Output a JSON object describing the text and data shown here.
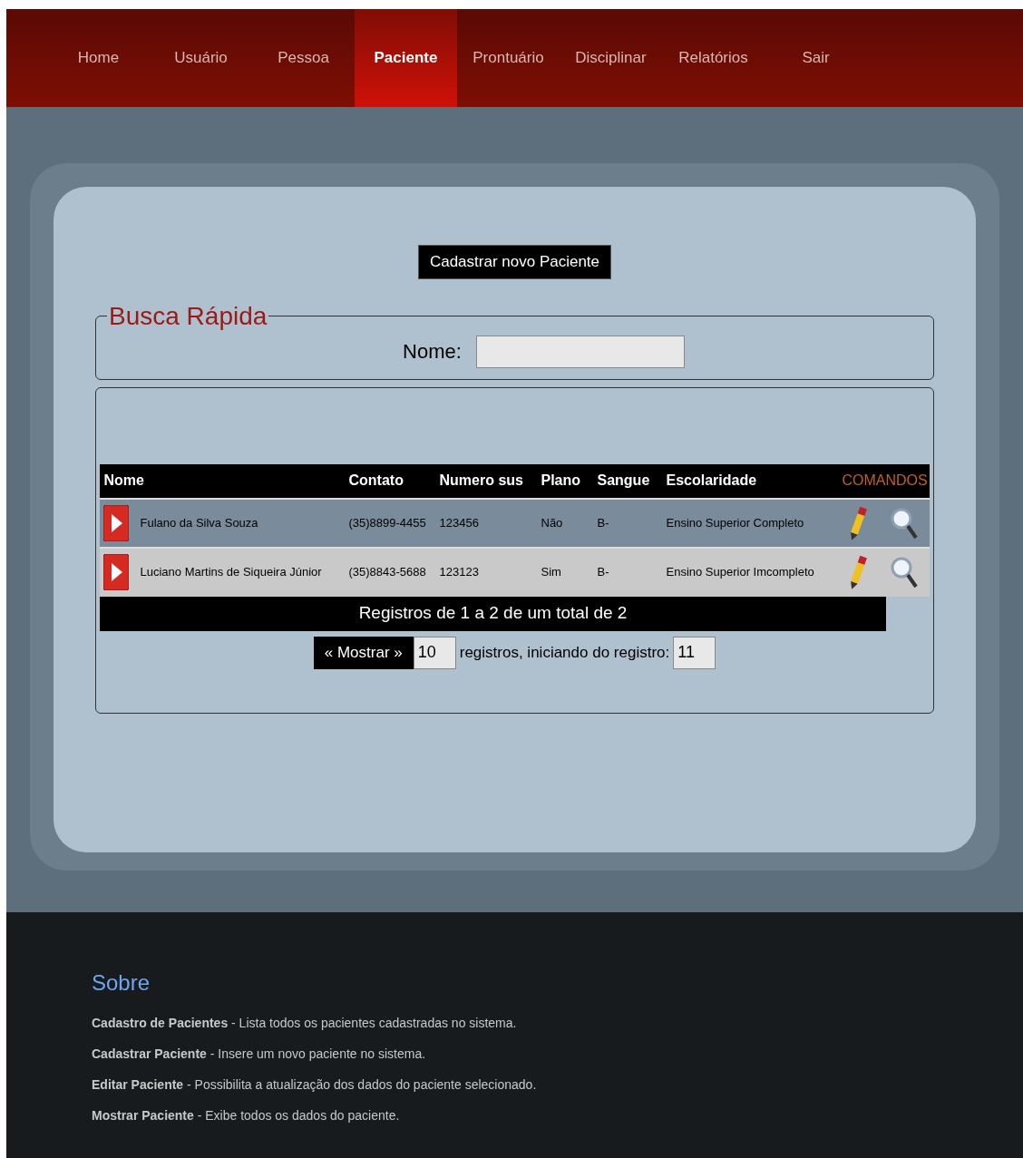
{
  "nav": [
    {
      "label": "Home",
      "selected": false
    },
    {
      "label": "Usuário",
      "selected": false
    },
    {
      "label": "Pessoa",
      "selected": false
    },
    {
      "label": "Paciente",
      "selected": true
    },
    {
      "label": "Prontuário",
      "selected": false
    },
    {
      "label": "Disciplinar",
      "selected": false
    },
    {
      "label": "Relatórios",
      "selected": false
    },
    {
      "label": "Sair",
      "selected": false
    }
  ],
  "new_button": "Cadastrar novo Paciente",
  "search": {
    "legend": "Busca Rápida",
    "label": "Nome:"
  },
  "table": {
    "columns": [
      "Nome",
      "Contato",
      "Numero sus",
      "Plano",
      "Sangue",
      "Escolaridade",
      "COMANDOS"
    ],
    "rows": [
      [
        "Fulano da Silva Souza",
        "(35)8899-4455",
        "123456",
        "Não",
        "B-",
        "Ensino Superior Completo"
      ],
      [
        "Luciano Martins de Siqueira Júnior",
        "(35)8843-5688",
        "123123",
        "Sim",
        "B-",
        "Ensino Superior Imcompleto"
      ]
    ],
    "summary": "Registros de 1 a 2 de um total de 2"
  },
  "pager": {
    "button": "« Mostrar »",
    "count": "10",
    "text": "registros, iniciando do registro:",
    "start": "11"
  },
  "footer": {
    "title": "Sobre",
    "lines": [
      "**Cadastro de Pacientes** - Lista todos os pacientes cadastradas no sistema.",
      "**Cadastrar Paciente** - Insere um novo paciente no sistema.",
      "**Editar Paciente** - Possibilita a atualização dos dados do paciente selecionado.",
      "**Mostrar Paciente** - Exibe todos os dados do paciente."
    ]
  }
}
